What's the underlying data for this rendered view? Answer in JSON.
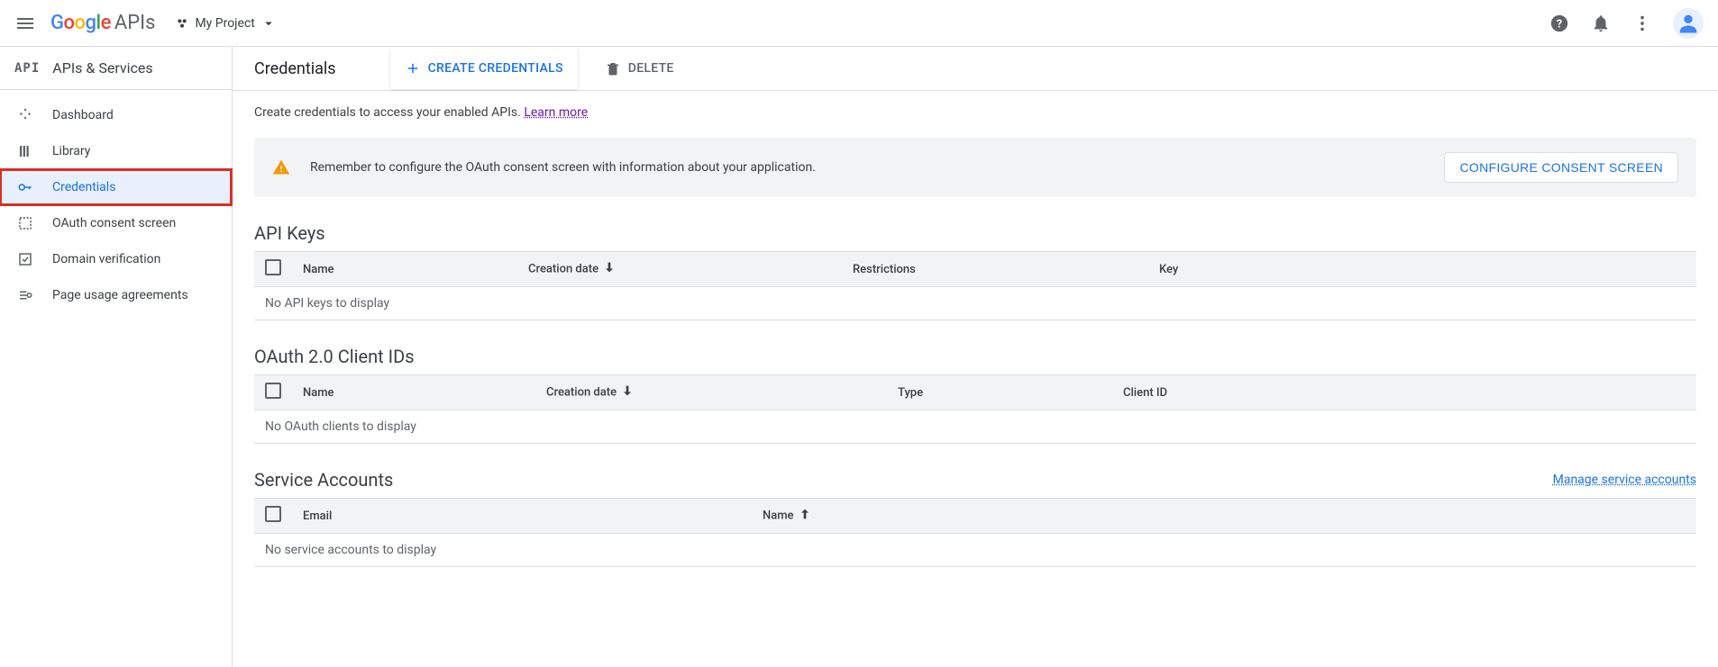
{
  "header": {
    "google": "Google",
    "apis": "APIs",
    "project": "My Project"
  },
  "sidebar": {
    "badge": "API",
    "title": "APIs & Services",
    "items": [
      {
        "label": "Dashboard"
      },
      {
        "label": "Library"
      },
      {
        "label": "Credentials"
      },
      {
        "label": "OAuth consent screen"
      },
      {
        "label": "Domain verification"
      },
      {
        "label": "Page usage agreements"
      }
    ]
  },
  "page": {
    "title": "Credentials",
    "create_btn": "CREATE CREDENTIALS",
    "delete_btn": "DELETE",
    "intro": "Create credentials to access your enabled APIs. ",
    "learn_more": "Learn more"
  },
  "alert": {
    "text": "Remember to configure the OAuth consent screen with information about your application.",
    "button": "CONFIGURE CONSENT SCREEN"
  },
  "sections": {
    "api_keys": {
      "title": "API Keys",
      "cols": [
        "Name",
        "Creation date",
        "Restrictions",
        "Key"
      ],
      "empty": "No API keys to display"
    },
    "oauth": {
      "title": "OAuth 2.0 Client IDs",
      "cols": [
        "Name",
        "Creation date",
        "Type",
        "Client ID"
      ],
      "empty": "No OAuth clients to display"
    },
    "service": {
      "title": "Service Accounts",
      "manage": "Manage service accounts",
      "cols": [
        "Email",
        "Name"
      ],
      "empty": "No service accounts to display"
    }
  }
}
